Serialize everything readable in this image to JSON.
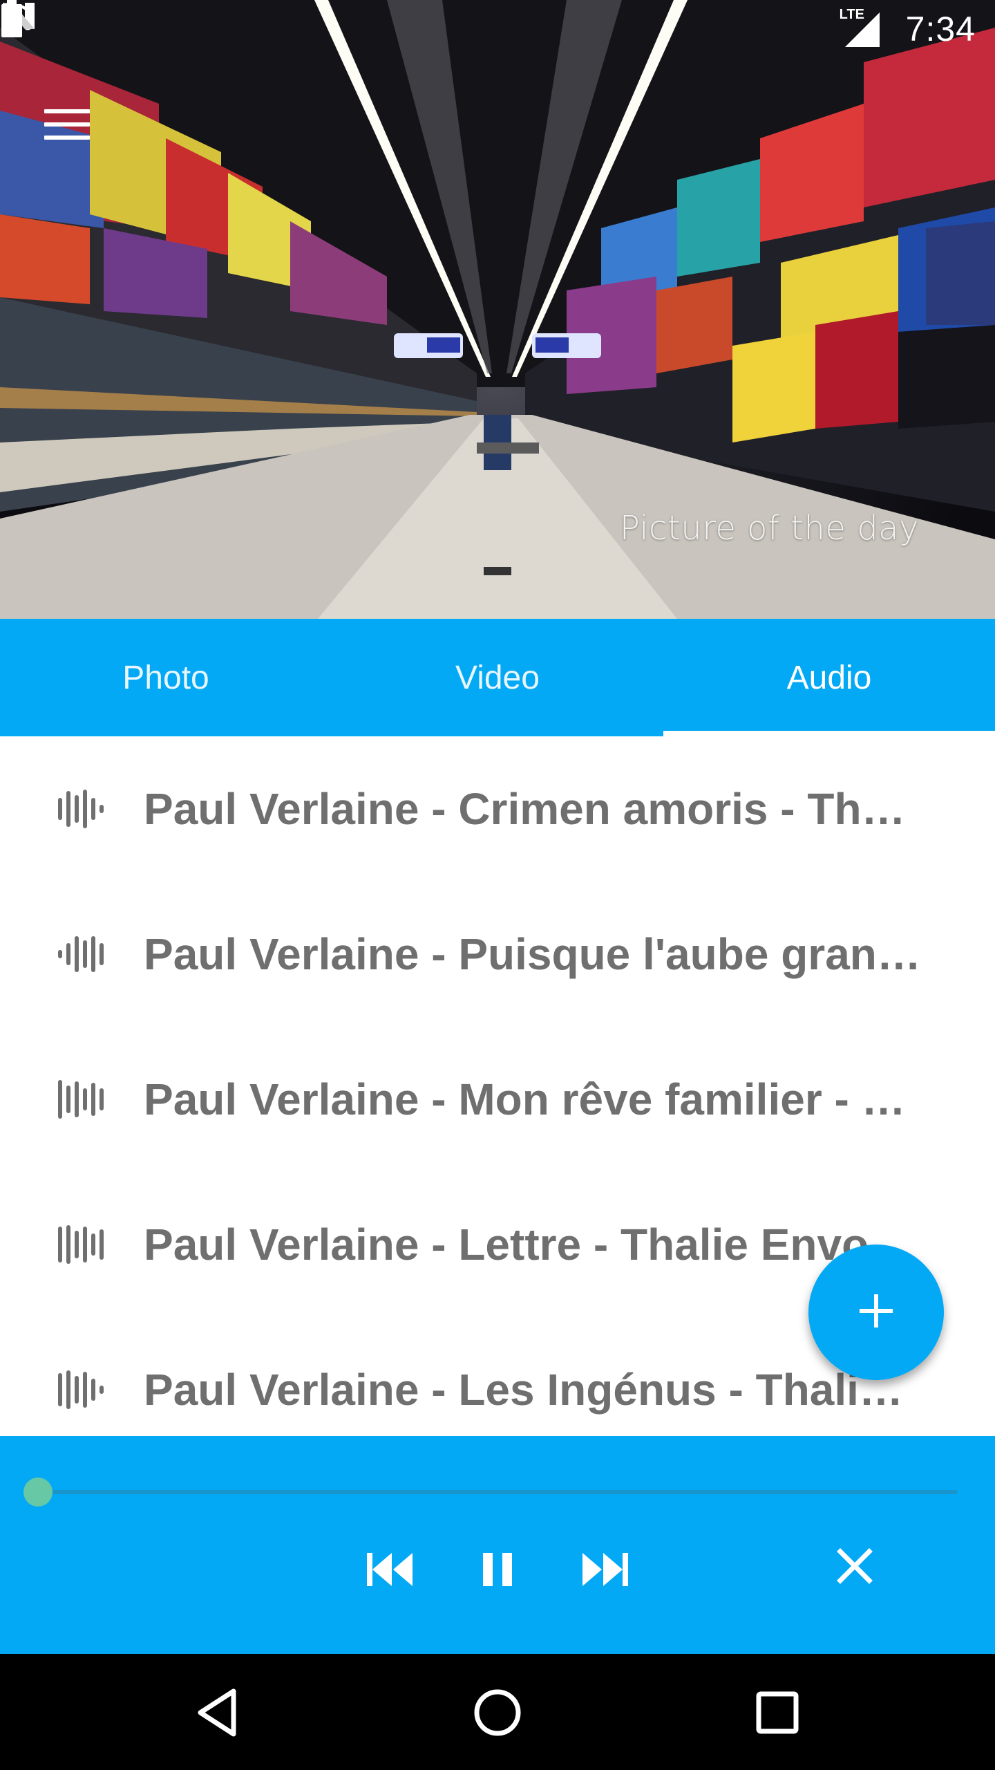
{
  "status_bar": {
    "time": "7:34",
    "network": "LTE",
    "icons": [
      "headphones-icon",
      "n-logo-icon",
      "lte-signal-icon",
      "battery-charging-icon"
    ]
  },
  "header": {
    "caption": "Picture of the day",
    "menu_icon": "hamburger-menu-icon"
  },
  "tabs": [
    {
      "label": "Photo",
      "active": false
    },
    {
      "label": "Video",
      "active": false
    },
    {
      "label": "Audio",
      "active": true
    }
  ],
  "audio_list": [
    {
      "title": "Paul Verlaine - Crimen amoris - Thalie Envolée",
      "icon": "audio-waveform-icon"
    },
    {
      "title": "Paul Verlaine - Puisque l'aube grandit - Thalie Envolée",
      "icon": "audio-waveform-icon"
    },
    {
      "title": "Paul Verlaine - Mon rêve familier - Thalie Envolée",
      "icon": "audio-waveform-icon"
    },
    {
      "title": "Paul Verlaine - Lettre - Thalie Envolée",
      "icon": "audio-waveform-icon"
    },
    {
      "title": "Paul Verlaine - Les Ingénus - Thalie Envolée",
      "icon": "audio-waveform-icon"
    }
  ],
  "fab": {
    "icon": "plus-icon"
  },
  "player": {
    "progress": 0.0,
    "controls": [
      "previous-icon",
      "pause-icon",
      "next-icon",
      "close-icon"
    ]
  },
  "colors": {
    "accent": "#03a9f4",
    "list_text": "#6f6f6f",
    "progress_knob": "#67c8a6"
  },
  "nav_bar": [
    "back-icon",
    "home-icon",
    "recents-icon"
  ]
}
